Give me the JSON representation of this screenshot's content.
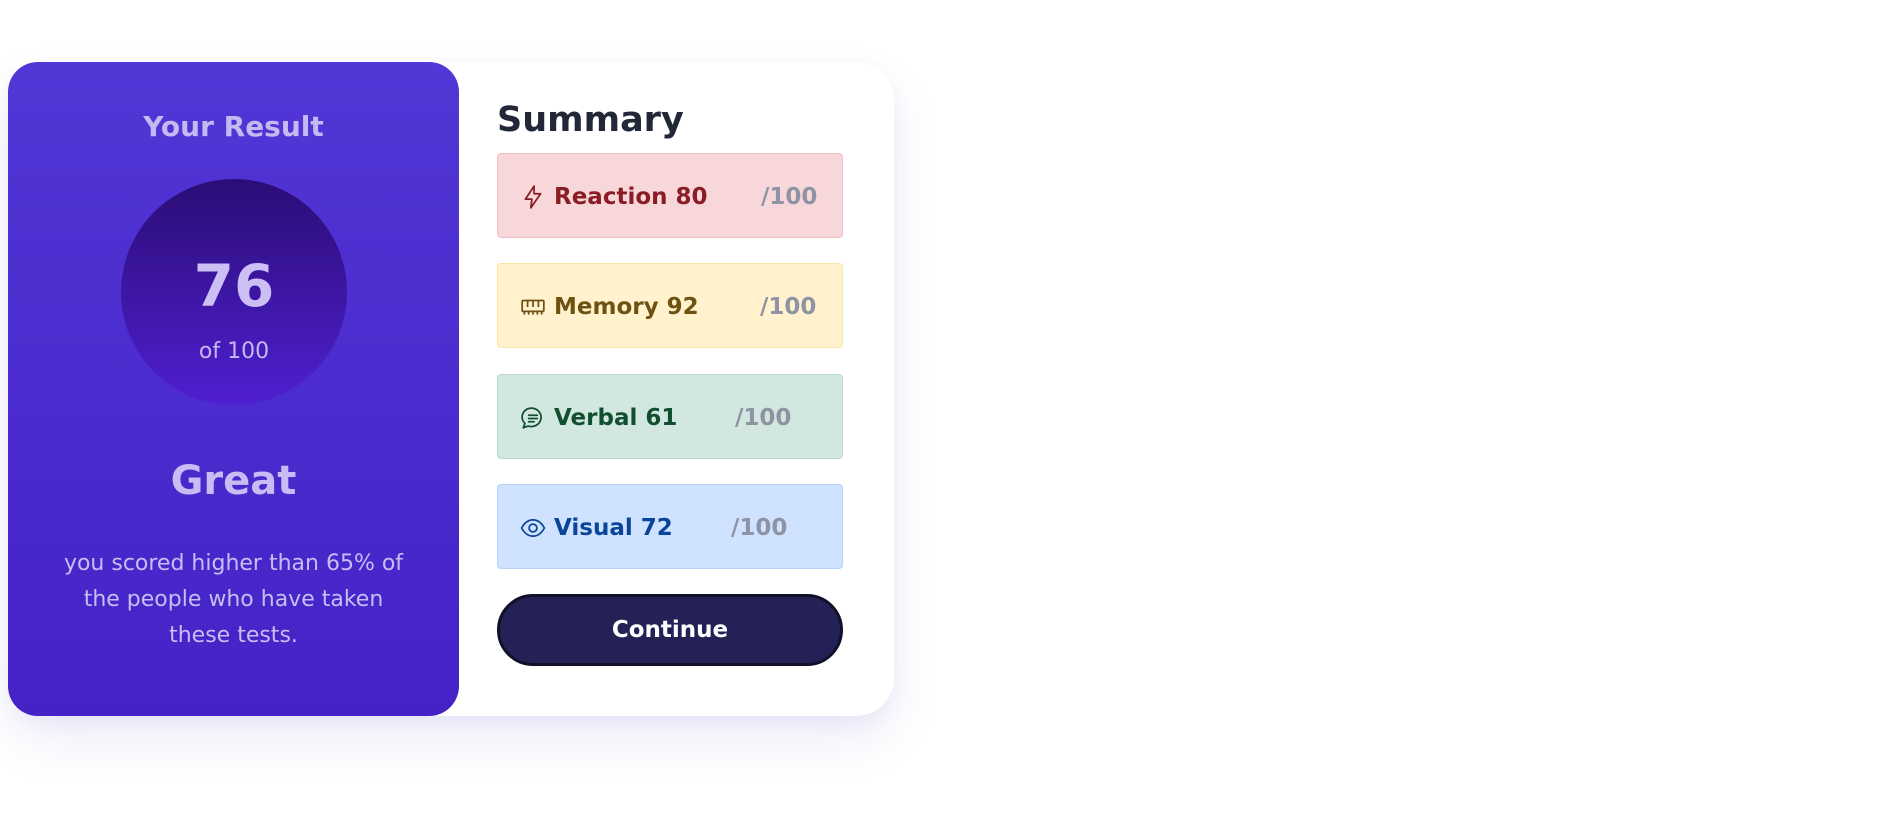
{
  "result": {
    "title": "Your Result",
    "score": "76",
    "score_of": "of 100",
    "rating": "Great",
    "description": "you scored higher than 65% of the people who have taken these tests."
  },
  "summary": {
    "title": "Summary",
    "rows": [
      {
        "icon": "lightning-icon",
        "label": "Reaction 80",
        "max": "/100",
        "color": "#8a1c24",
        "background": "#f8d7da"
      },
      {
        "icon": "memory-chip-icon",
        "label": "Memory 92",
        "max": "/100",
        "color": "#6f5211",
        "background": "#fff2cc"
      },
      {
        "icon": "chat-bubble-icon",
        "label": "Verbal 61",
        "max": "/100",
        "color": "#124f31",
        "background": "#d2e7df"
      },
      {
        "icon": "eye-icon",
        "label": "Visual 72",
        "max": "/100",
        "color": "#0b4599",
        "background": "#cfe2ff"
      }
    ]
  },
  "actions": {
    "continue_label": "Continue"
  },
  "colors": {
    "result_panel": "#4a2bcf",
    "score_circle": "#3a16a0",
    "button": "#232156"
  }
}
